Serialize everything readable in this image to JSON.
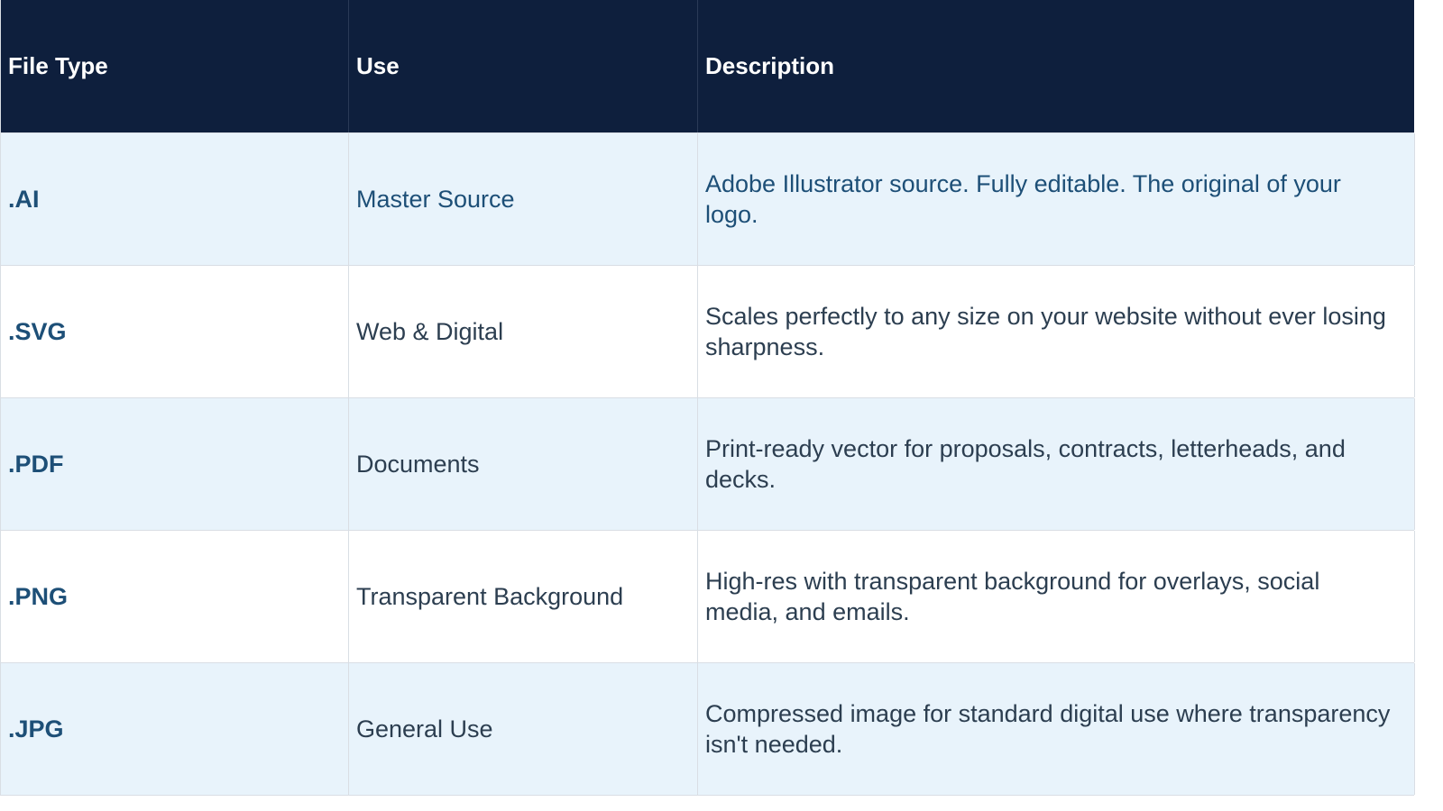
{
  "table": {
    "headers": {
      "file_type": "File Type",
      "use": "Use",
      "description": "Description"
    },
    "rows": [
      {
        "file_type": ".AI",
        "use": "Master Source",
        "description": "Adobe Illustrator source. Fully editable. The original of your logo."
      },
      {
        "file_type": ".SVG",
        "use": "Web & Digital",
        "description": "Scales perfectly to any size on your website without ever losing sharpness."
      },
      {
        "file_type": ".PDF",
        "use": "Documents",
        "description": "Print-ready vector for proposals, contracts, letterheads, and decks."
      },
      {
        "file_type": ".PNG",
        "use": "Transparent Background",
        "description": "High-res with transparent background for overlays, social media, and emails."
      },
      {
        "file_type": ".JPG",
        "use": "General Use",
        "description": "Compressed image for standard digital use where transparency isn't needed."
      }
    ]
  },
  "colors": {
    "header_bg": "#0e1f3d",
    "row_shaded": "#e8f3fb",
    "row_plain": "#ffffff",
    "accent_text": "#1d4f77",
    "body_text": "#2c3e50"
  }
}
